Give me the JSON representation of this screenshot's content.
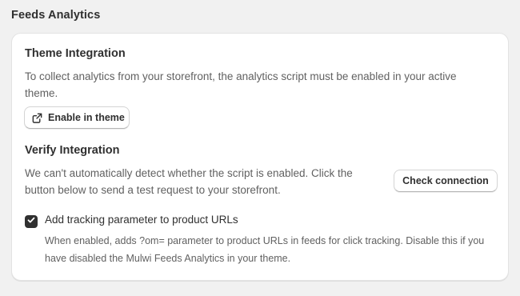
{
  "section": {
    "title": "Feeds Analytics"
  },
  "theme_integration": {
    "heading": "Theme Integration",
    "description": "To collect analytics from your storefront, the analytics script must be enabled in your active theme.",
    "button_label": "Enable in theme",
    "button_icon": "external-link-icon"
  },
  "verify_integration": {
    "heading": "Verify Integration",
    "description": "We can't automatically detect whether the script is enabled. Click the button below to send a test request to your storefront.",
    "button_label": "Check connection"
  },
  "tracking_option": {
    "label": "Add tracking parameter to product URLs",
    "checked": true,
    "help_text": "When enabled, adds ?om= parameter to product URLs in feeds for click tracking. Disable this if you have disabled the Mulwi Feeds Analytics in your theme."
  },
  "colors": {
    "page_background": "#f1f1f1",
    "card_background": "#ffffff",
    "checkbox_fill": "#303030",
    "text_primary": "#303030",
    "text_secondary": "#616161"
  }
}
